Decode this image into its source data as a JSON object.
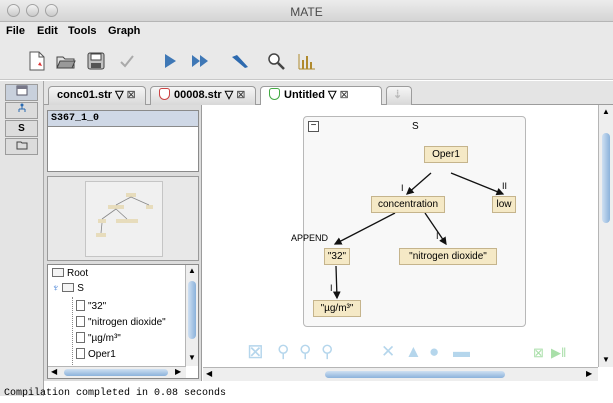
{
  "window": {
    "title": "MATE"
  },
  "menu": [
    "File",
    "Edit",
    "Tools",
    "Graph"
  ],
  "toolbar": [
    "new-document-icon",
    "open-icon",
    "save-icon",
    "check-icon",
    "play-icon",
    "fast-forward-icon",
    "step-icon",
    "search-icon",
    "chart-icon"
  ],
  "left_tabs": [
    "S"
  ],
  "tabs": [
    {
      "label": "conc01.str",
      "active": false
    },
    {
      "label": "00008.str",
      "active": false
    },
    {
      "label": "Untitled",
      "active": true
    }
  ],
  "sequence": {
    "selected": "S367_1_0"
  },
  "tree_panel": {
    "items": [
      "Root",
      "S",
      "\"32\"",
      "\"nitrogen dioxide\"",
      "\"µg/m³\"",
      "Oper1"
    ]
  },
  "graph": {
    "collapse_label": "−",
    "root_label": "S",
    "nodes": {
      "oper1": "Oper1",
      "concentration": "concentration",
      "low": "low",
      "n32": "\"32\"",
      "nitrogen": "\"nitrogen dioxide\"",
      "ugm": "\"µg/m³\""
    },
    "edges": {
      "e1": "I",
      "e2": "II",
      "e3": "APPEND",
      "e4": "I",
      "e5": "I"
    }
  },
  "status": "Compilation completed in 0.08 seconds",
  "colors": {
    "node": "#f5e9c6",
    "accent": "#b5d6ec"
  }
}
